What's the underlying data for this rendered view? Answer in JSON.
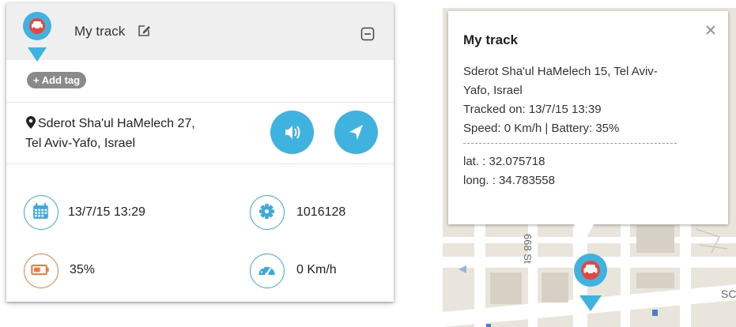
{
  "panel": {
    "title": "My track",
    "add_tag_label": "+ Add tag",
    "address_line1": "Sderot Sha'ul HaMelech 27,",
    "address_line2": "Tel Aviv-Yafo, Israel",
    "stats": {
      "datetime": "13/7/15 13:29",
      "id": "1016128",
      "battery": "35%",
      "speed": "0 Km/h"
    }
  },
  "popup": {
    "title": "My track",
    "address": "Sderot Sha'ul HaMelech 15, Tel Aviv-Yafo, Israel",
    "tracked_on": "Tracked on: 13/7/15 13:39",
    "speed_battery": "Speed: 0 Km/h | Battery: 35%",
    "lat": "lat. : 32.075718",
    "long": "long. : 34.783558"
  },
  "map": {
    "street_label": "668 St",
    "street_label_right": "SC"
  },
  "colors": {
    "accent_blue": "#3fb2e0",
    "marker_red": "#e8453c",
    "battery_orange": "#ef7a3a",
    "header_gray": "#efefef",
    "tag_gray": "#8a8a8a"
  },
  "icons": [
    "car-pin-icon",
    "edit-icon",
    "collapse-icon",
    "location-marker-icon",
    "volume-icon",
    "navigate-icon",
    "calendar-icon",
    "cog-icon",
    "battery-icon",
    "speedometer-icon",
    "close-icon"
  ]
}
